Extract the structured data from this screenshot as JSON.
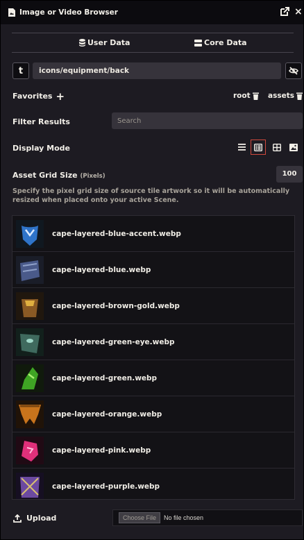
{
  "window": {
    "title": "Image or Video Browser"
  },
  "tabs": [
    {
      "label": "User Data"
    },
    {
      "label": "Core Data"
    }
  ],
  "path": {
    "toggle_label": "t",
    "value": "icons/equipment/back"
  },
  "favorites": {
    "label": "Favorites",
    "items": [
      {
        "label": "root"
      },
      {
        "label": "assets"
      }
    ]
  },
  "filter": {
    "label": "Filter Results",
    "placeholder": "Search"
  },
  "display_mode": {
    "label": "Display Mode",
    "active": "list-thumbnails"
  },
  "grid_size": {
    "label": "Asset Grid Size",
    "unit": "(Pixels)",
    "value": "100",
    "help": "Specify the pixel grid size of source tile artwork so it will be automatically resized when placed onto your active Scene."
  },
  "files": [
    {
      "name": "cape-layered-blue-accent.webp",
      "color": "#2f74c9"
    },
    {
      "name": "cape-layered-blue.webp",
      "color": "#4a5a8a"
    },
    {
      "name": "cape-layered-brown-gold.webp",
      "color": "#8a5a24"
    },
    {
      "name": "cape-layered-green-eye.webp",
      "color": "#3f6a5e"
    },
    {
      "name": "cape-layered-green.webp",
      "color": "#3fa524"
    },
    {
      "name": "cape-layered-orange.webp",
      "color": "#c8741c"
    },
    {
      "name": "cape-layered-pink.webp",
      "color": "#e0307a"
    },
    {
      "name": "cape-layered-purple.webp",
      "color": "#6c4aa0"
    }
  ],
  "upload": {
    "label": "Upload",
    "choose_label": "Choose File",
    "status": "No file chosen"
  },
  "colors": {
    "accent": "#d0493d",
    "panel": "#1d1b22",
    "input": "#36333b"
  }
}
